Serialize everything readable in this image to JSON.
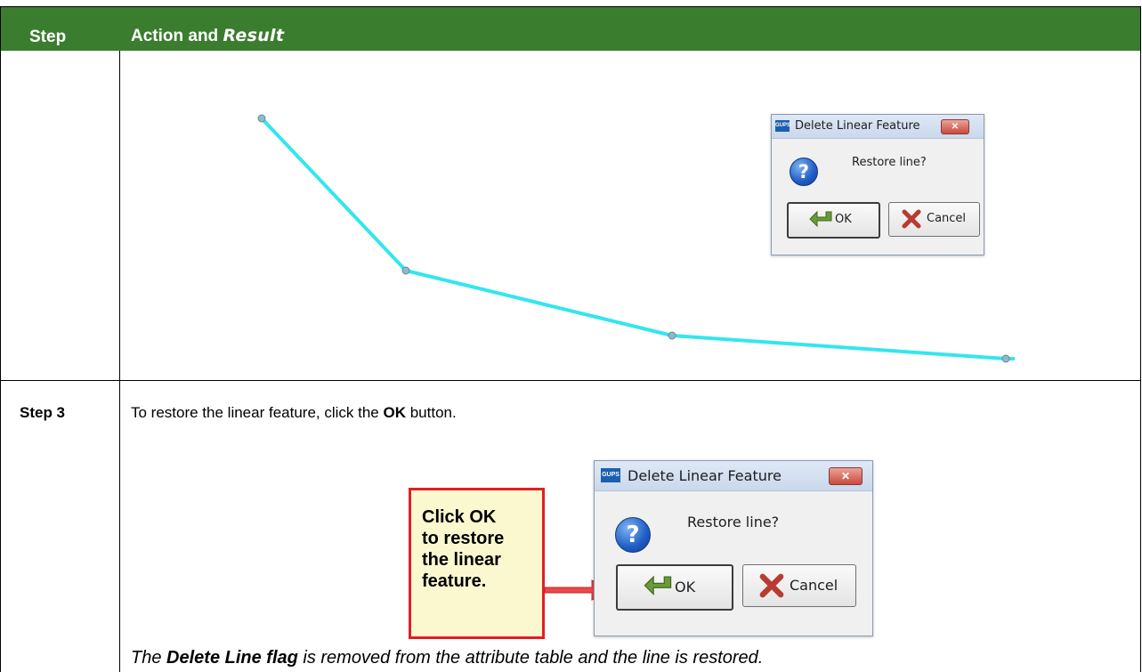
{
  "table": {
    "header": {
      "step": "Step",
      "action": "Action and ",
      "result_word": "Result"
    },
    "step3_label": "Step 3"
  },
  "step3": {
    "instruction_before": "To restore the linear feature, click the ",
    "instruction_bold": "OK",
    "instruction_after": " button.",
    "callout": "Click OK\nto restore\nthe linear\nfeature.",
    "result_before": "The ",
    "result_bold": "Delete Line flag",
    "result_after": " is removed from the attribute table and the line is restored."
  },
  "dialog": {
    "app_icon": "GUPS",
    "title": "Delete Linear Feature",
    "close_glyph": "✕",
    "message": "Restore line?",
    "question_glyph": "?",
    "ok_label": "OK",
    "cancel_label": "Cancel"
  },
  "map": {
    "line_color": "#33e6ee",
    "vertex_color": "#8fb9c8"
  },
  "colors": {
    "header_bg": "#3b7d2f",
    "callout_border": "#e11f26",
    "callout_bg": "#fbf8d0"
  }
}
